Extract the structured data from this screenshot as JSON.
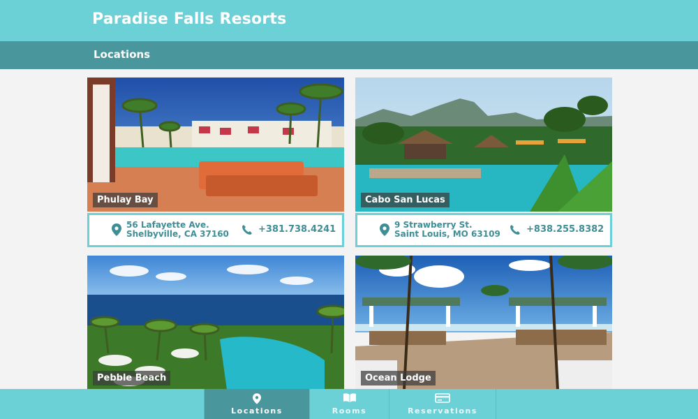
{
  "app": {
    "title": "Paradise Falls Resorts"
  },
  "subheader": {
    "title": "Locations"
  },
  "locations": [
    {
      "name": "Phulay Bay",
      "address_line1": "56 Lafayette Ave.",
      "address_line2": "Shelbyville, CA 37160",
      "phone": "+381.738.4241"
    },
    {
      "name": "Cabo San Lucas",
      "address_line1": "9 Strawberry St.",
      "address_line2": "Saint Louis, MO 63109",
      "phone": "+838.255.8382"
    },
    {
      "name": "Pebble Beach"
    },
    {
      "name": "Ocean Lodge"
    }
  ],
  "nav": {
    "items": [
      {
        "label": "Locations",
        "icon": "map-pin-icon",
        "active": true
      },
      {
        "label": "Rooms",
        "icon": "book-icon",
        "active": false
      },
      {
        "label": "Reservations",
        "icon": "credit-card-icon",
        "active": false
      }
    ]
  },
  "colors": {
    "primary": "#6cd0d7",
    "primary_dark": "#4a969d",
    "text_accent": "#3f8e95"
  }
}
